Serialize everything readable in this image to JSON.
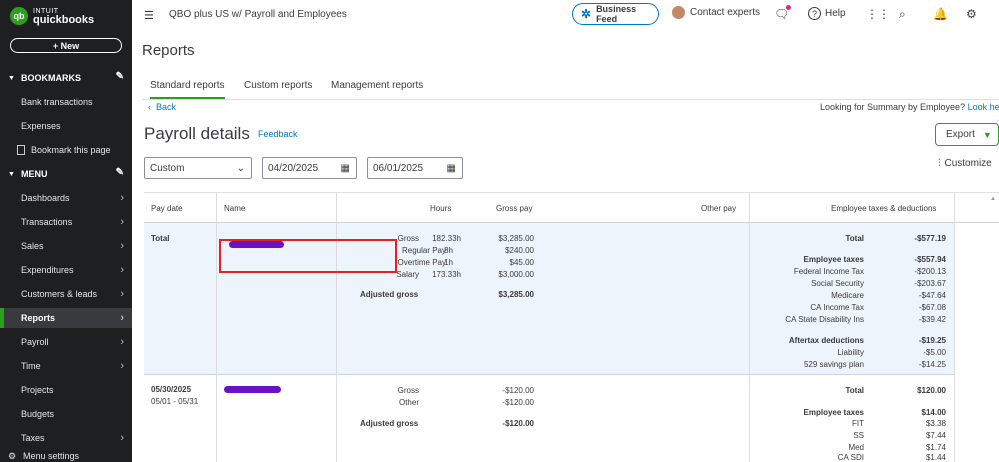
{
  "app": {
    "logo_top": "INTUIT",
    "logo_bottom": "quickbooks",
    "logo_mark": "qb",
    "new_button": "+ New"
  },
  "sidebar": {
    "bookmarks_heading": "BOOKMARKS",
    "bookmarks": [
      "Bank transactions",
      "Expenses",
      "Bookmark this page"
    ],
    "menu_heading": "MENU",
    "menu": [
      {
        "label": "Dashboards",
        "arrow": true
      },
      {
        "label": "Transactions",
        "arrow": true
      },
      {
        "label": "Sales",
        "arrow": true
      },
      {
        "label": "Expenditures",
        "arrow": true
      },
      {
        "label": "Customers & leads",
        "arrow": true
      },
      {
        "label": "Reports",
        "arrow": true,
        "active": true
      },
      {
        "label": "Payroll",
        "arrow": true
      },
      {
        "label": "Time",
        "arrow": true
      },
      {
        "label": "Projects",
        "arrow": false
      },
      {
        "label": "Budgets",
        "arrow": false
      },
      {
        "label": "Taxes",
        "arrow": true
      }
    ],
    "menu_settings": "Menu settings"
  },
  "topbar": {
    "company": "QBO plus US w/ Payroll and Employees",
    "business_feed": "Business Feed",
    "contact_experts": "Contact experts",
    "help": "Help"
  },
  "page": {
    "title": "Reports",
    "tabs": [
      "Standard reports",
      "Custom reports",
      "Management reports"
    ],
    "back": "Back",
    "looking_for": "Looking for Summary by Employee?",
    "look_here": "Look here",
    "report_title": "Payroll details",
    "feedback": "Feedback",
    "export": "Export",
    "customize": "Customize"
  },
  "filters": {
    "range": "Custom",
    "start": "04/20/2025",
    "end": "06/01/2025"
  },
  "table": {
    "headers": {
      "pay_date": "Pay date",
      "name": "Name",
      "hours": "Hours",
      "gross_pay": "Gross pay",
      "other_pay": "Other pay",
      "taxes": "Employee taxes & deductions"
    },
    "row1": {
      "date": "Total",
      "gross_label": "Gross",
      "gross_hours": "182.33h",
      "gross_amount": "$3,285.00",
      "regular_label": "Regular Pay",
      "regular_hours": "8h",
      "regular_amount": "$240.00",
      "overtime_label": "Overtime Pay",
      "overtime_hours": "1h",
      "overtime_amount": "$45.00",
      "salary_label": "Salary",
      "salary_hours": "173.33h",
      "salary_amount": "$3,000.00",
      "adjusted_label": "Adjusted gross",
      "adjusted_amount": "$3,285.00",
      "taxes": [
        {
          "label": "Total",
          "value": "-$577.19",
          "bold": true
        },
        {
          "label": "Employee taxes",
          "value": "-$557.94",
          "bold": true
        },
        {
          "label": "Federal Income Tax",
          "value": "-$200.13"
        },
        {
          "label": "Social Security",
          "value": "-$203.67"
        },
        {
          "label": "Medicare",
          "value": "-$47.64"
        },
        {
          "label": "CA Income Tax",
          "value": "-$67.08"
        },
        {
          "label": "CA State Disability Ins",
          "value": "-$39.42"
        },
        {
          "label": "Aftertax deductions",
          "value": "-$19.25",
          "bold": true
        },
        {
          "label": "Liability",
          "value": "-$5.00"
        },
        {
          "label": "529 savings plan",
          "value": "-$14.25"
        }
      ]
    },
    "row2": {
      "date": "05/30/2025",
      "period": "05/01 - 05/31",
      "gross_label": "Gross",
      "gross_amount": "-$120.00",
      "other_label": "Other",
      "other_amount": "-$120.00",
      "adjusted_label": "Adjusted gross",
      "adjusted_amount": "-$120.00",
      "taxes": [
        {
          "label": "Total",
          "value": "$120.00",
          "bold": true
        },
        {
          "label": "Employee taxes",
          "value": "$14.00",
          "bold": true
        },
        {
          "label": "FIT",
          "value": "$3.38"
        },
        {
          "label": "SS",
          "value": "$7.44"
        },
        {
          "label": "Med",
          "value": "$1.74"
        },
        {
          "label": "CA SDI",
          "value": "$1.44"
        }
      ]
    }
  }
}
